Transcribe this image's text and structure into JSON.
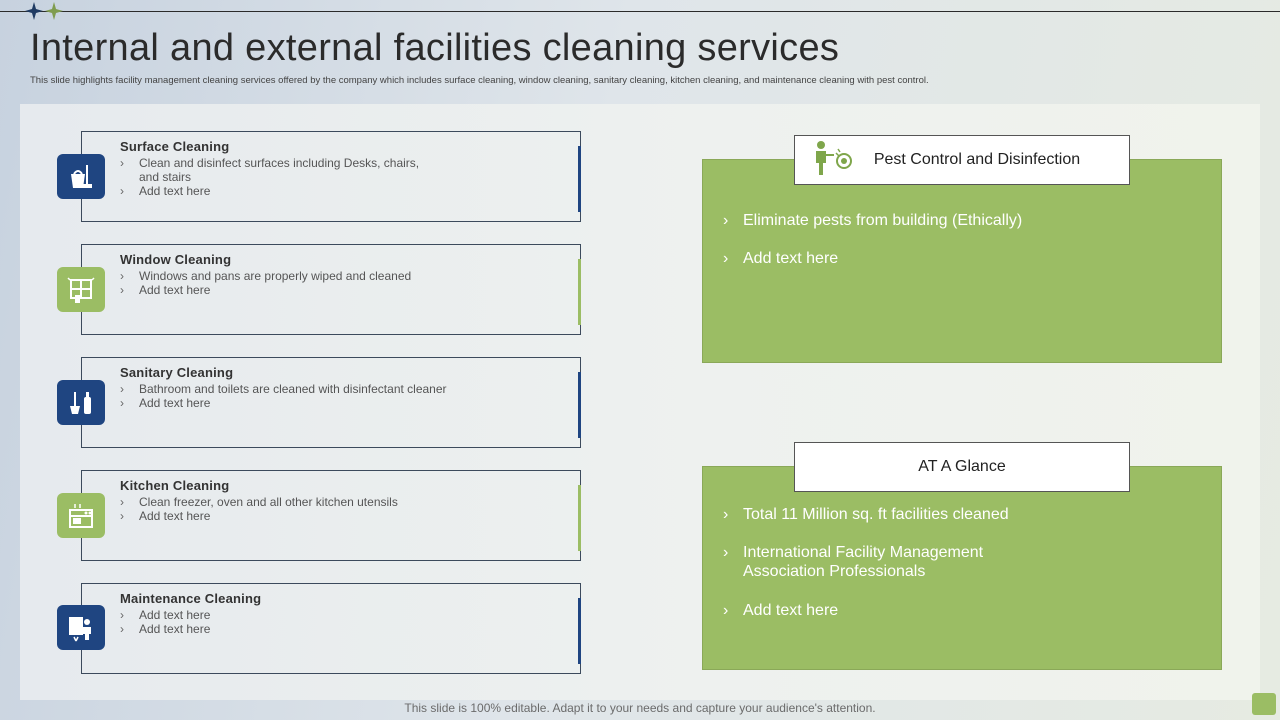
{
  "title": "Internal and external facilities cleaning services",
  "subtitle": "This slide highlights facility management  cleaning services offered by the company which includes surface cleaning, window cleaning, sanitary cleaning, kitchen cleaning, and maintenance  cleaning with pest control.",
  "services": [
    {
      "title": "Surface Cleaning",
      "b1": "Clean and disinfect surfaces including Desks, chairs, and stairs",
      "b2": "Add text here",
      "icon": "bucket-cleaning-icon",
      "color": "#1f4581"
    },
    {
      "title": "Window Cleaning",
      "b1": "Windows and pans are properly wiped and cleaned",
      "b2": "Add text here",
      "icon": "window-icon",
      "color": "#9bbd64"
    },
    {
      "title": "Sanitary Cleaning",
      "b1": "Bathroom and toilets are cleaned with disinfectant cleaner",
      "b2": "Add text here",
      "icon": "toilet-brush-icon",
      "color": "#1f4581"
    },
    {
      "title": "Kitchen Cleaning",
      "b1": "Clean freezer, oven and all other kitchen utensils",
      "b2": "Add text here",
      "icon": "kitchen-icon",
      "color": "#9bbd64"
    },
    {
      "title": "Maintenance Cleaning",
      "b1": "Add text here",
      "b2": "Add text here",
      "icon": "maintenance-worker-icon",
      "color": "#1f4581"
    }
  ],
  "pest": {
    "title": "Pest Control and Disinfection",
    "icon": "pest-spray-icon",
    "items": [
      "Eliminate pests from building (Ethically)",
      "Add text here"
    ]
  },
  "glance": {
    "title": "AT A Glance",
    "items": [
      "Total 11 Million sq. ft facilities cleaned",
      "International  Facility Management Association Professionals",
      "Add text here"
    ]
  },
  "footer": "This slide is 100% editable. Adapt it to your needs and capture your audience's attention.",
  "colors": {
    "navy": "#1f4581",
    "green": "#9bbd64"
  }
}
